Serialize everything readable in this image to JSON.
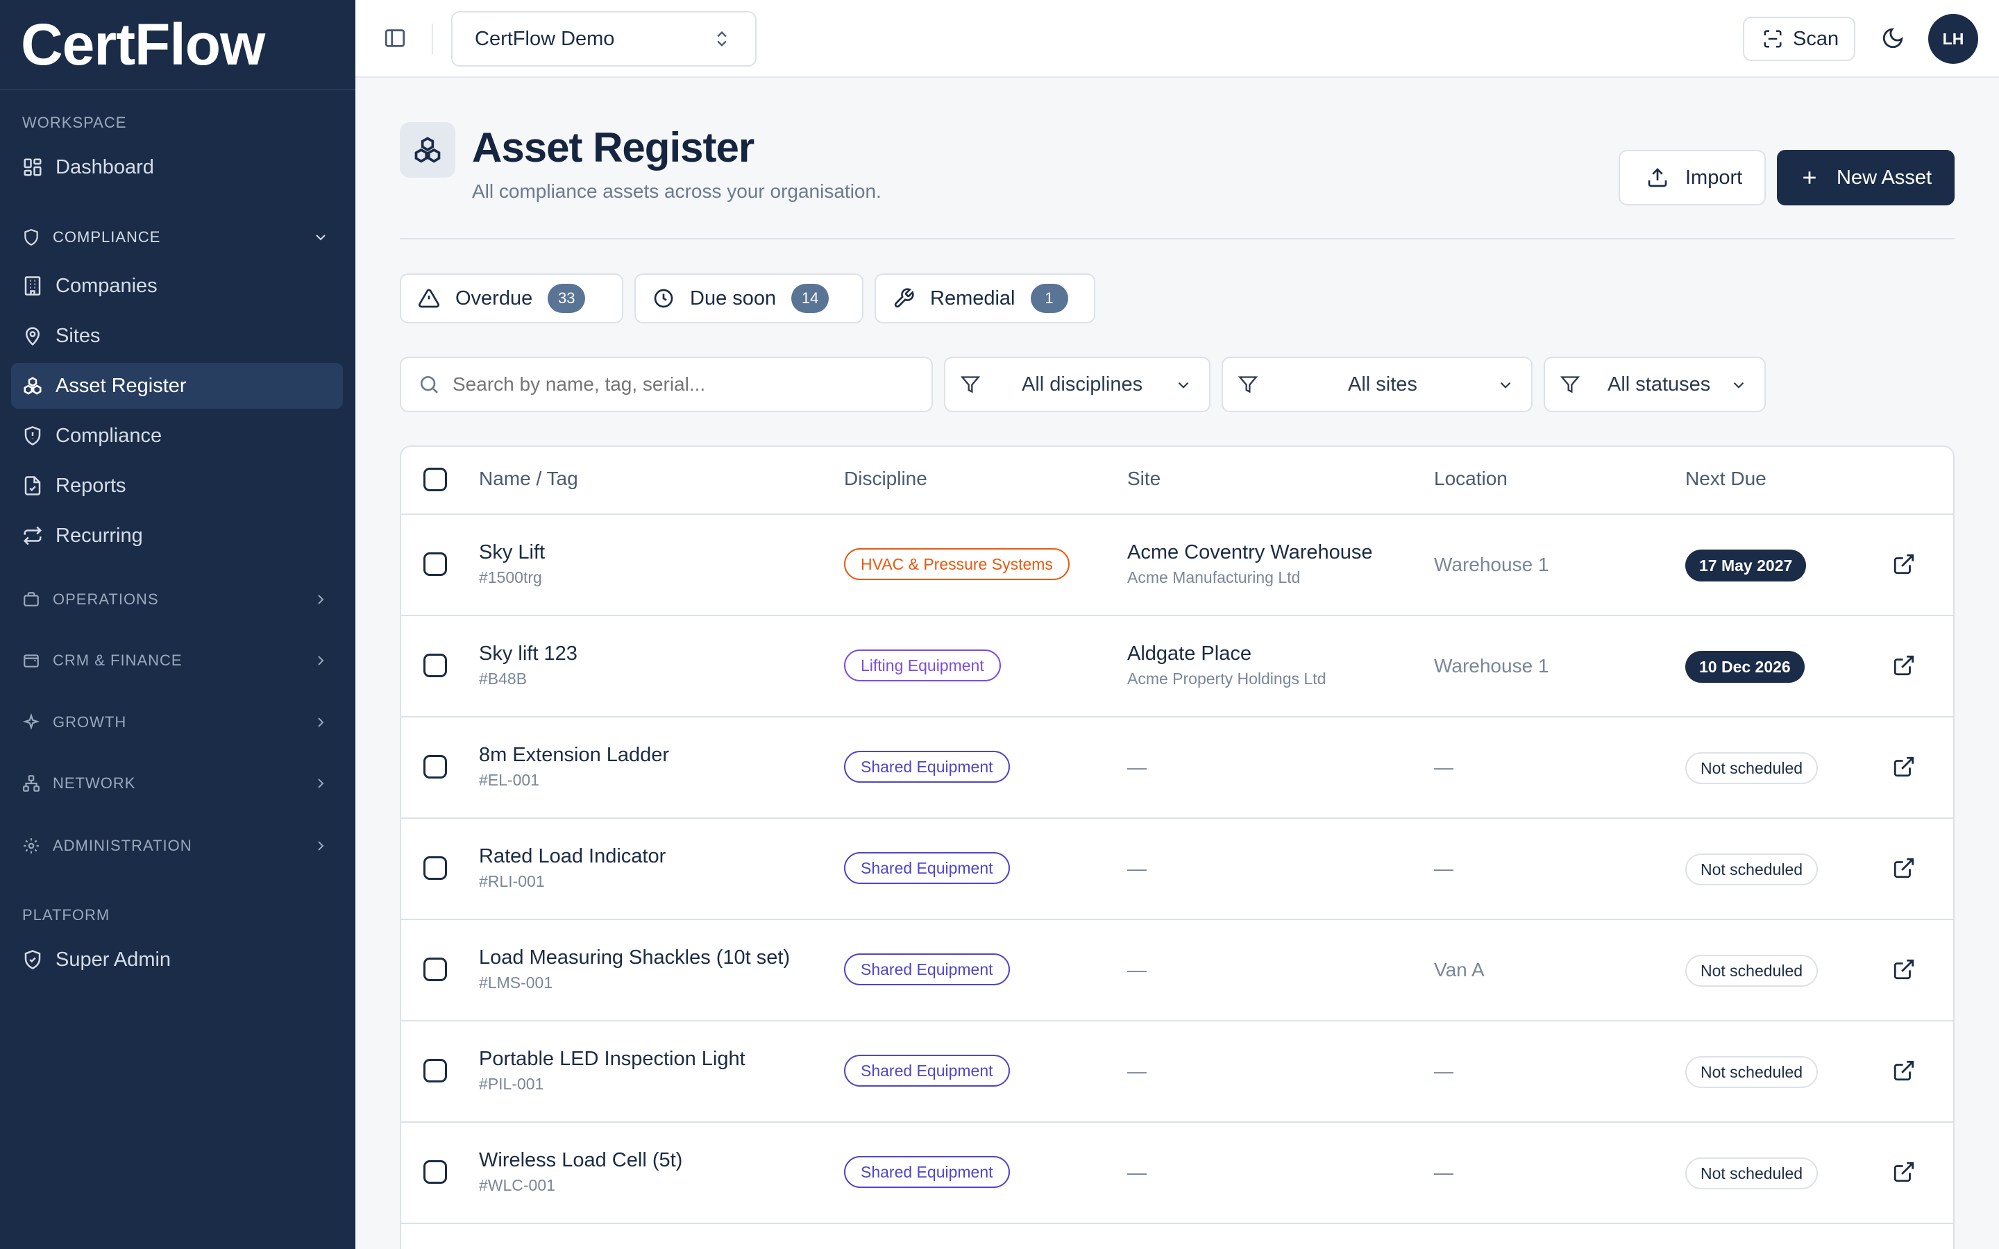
{
  "app": {
    "logo": "CertFlow"
  },
  "sidebar": {
    "sections": {
      "workspace": "WORKSPACE",
      "platform": "PLATFORM"
    },
    "items": {
      "dashboard": "Dashboard",
      "companies": "Companies",
      "sites": "Sites",
      "asset_register": "Asset Register",
      "compliance": "Compliance",
      "reports": "Reports",
      "recurring": "Recurring",
      "super_admin": "Super Admin"
    },
    "groups": {
      "compliance": "COMPLIANCE",
      "operations": "OPERATIONS",
      "crm_finance": "CRM & FINANCE",
      "growth": "GROWTH",
      "network": "NETWORK",
      "administration": "ADMINISTRATION"
    }
  },
  "topbar": {
    "org_selector": "CertFlow Demo",
    "scan_label": "Scan",
    "avatar_initials": "LH"
  },
  "page": {
    "title": "Asset Register",
    "subtitle": "All compliance assets across your organisation.",
    "import_label": "Import",
    "new_asset_label": "New Asset"
  },
  "quick_filters": [
    {
      "label": "Overdue",
      "count": "33"
    },
    {
      "label": "Due soon",
      "count": "14"
    },
    {
      "label": "Remedial",
      "count": "1"
    }
  ],
  "filters": {
    "search_placeholder": "Search by name, tag, serial...",
    "discipline": "All disciplines",
    "site": "All sites",
    "status": "All statuses"
  },
  "table": {
    "columns": [
      "Name / Tag",
      "Discipline",
      "Site",
      "Location",
      "Next Due"
    ],
    "rows": [
      {
        "name": "Sky Lift",
        "tag": "#1500trg",
        "discipline": "HVAC & Pressure Systems",
        "site": "Acme Coventry Warehouse",
        "company": "Acme Manufacturing Ltd",
        "location": "Warehouse 1",
        "next_due": "17 May 2027"
      },
      {
        "name": "Sky lift 123",
        "tag": "#B48B",
        "discipline": "Lifting Equipment",
        "site": "Aldgate Place",
        "company": "Acme Property Holdings Ltd",
        "location": "Warehouse 1",
        "next_due": "10 Dec 2026"
      },
      {
        "name": "8m Extension Ladder",
        "tag": "#EL-001",
        "discipline": "Shared Equipment",
        "site": "—",
        "company": "",
        "location": "—",
        "next_due": "Not scheduled"
      },
      {
        "name": "Rated Load Indicator",
        "tag": "#RLI-001",
        "discipline": "Shared Equipment",
        "site": "—",
        "company": "",
        "location": "—",
        "next_due": "Not scheduled"
      },
      {
        "name": "Load Measuring Shackles (10t set)",
        "tag": "#LMS-001",
        "discipline": "Shared Equipment",
        "site": "—",
        "company": "",
        "location": "Van A",
        "next_due": "Not scheduled"
      },
      {
        "name": "Portable LED Inspection Light",
        "tag": "#PIL-001",
        "discipline": "Shared Equipment",
        "site": "—",
        "company": "",
        "location": "—",
        "next_due": "Not scheduled"
      },
      {
        "name": "Wireless Load Cell (5t)",
        "tag": "#WLC-001",
        "discipline": "Shared Equipment",
        "site": "—",
        "company": "",
        "location": "—",
        "next_due": "Not scheduled"
      }
    ]
  },
  "colors": {
    "sidebar_bg": "#1a2c47",
    "primary": "#1a2c47",
    "hvac_badge": "#e8590c",
    "lifting_badge": "#7c4ddb",
    "shared_badge": "#4f46c8"
  }
}
